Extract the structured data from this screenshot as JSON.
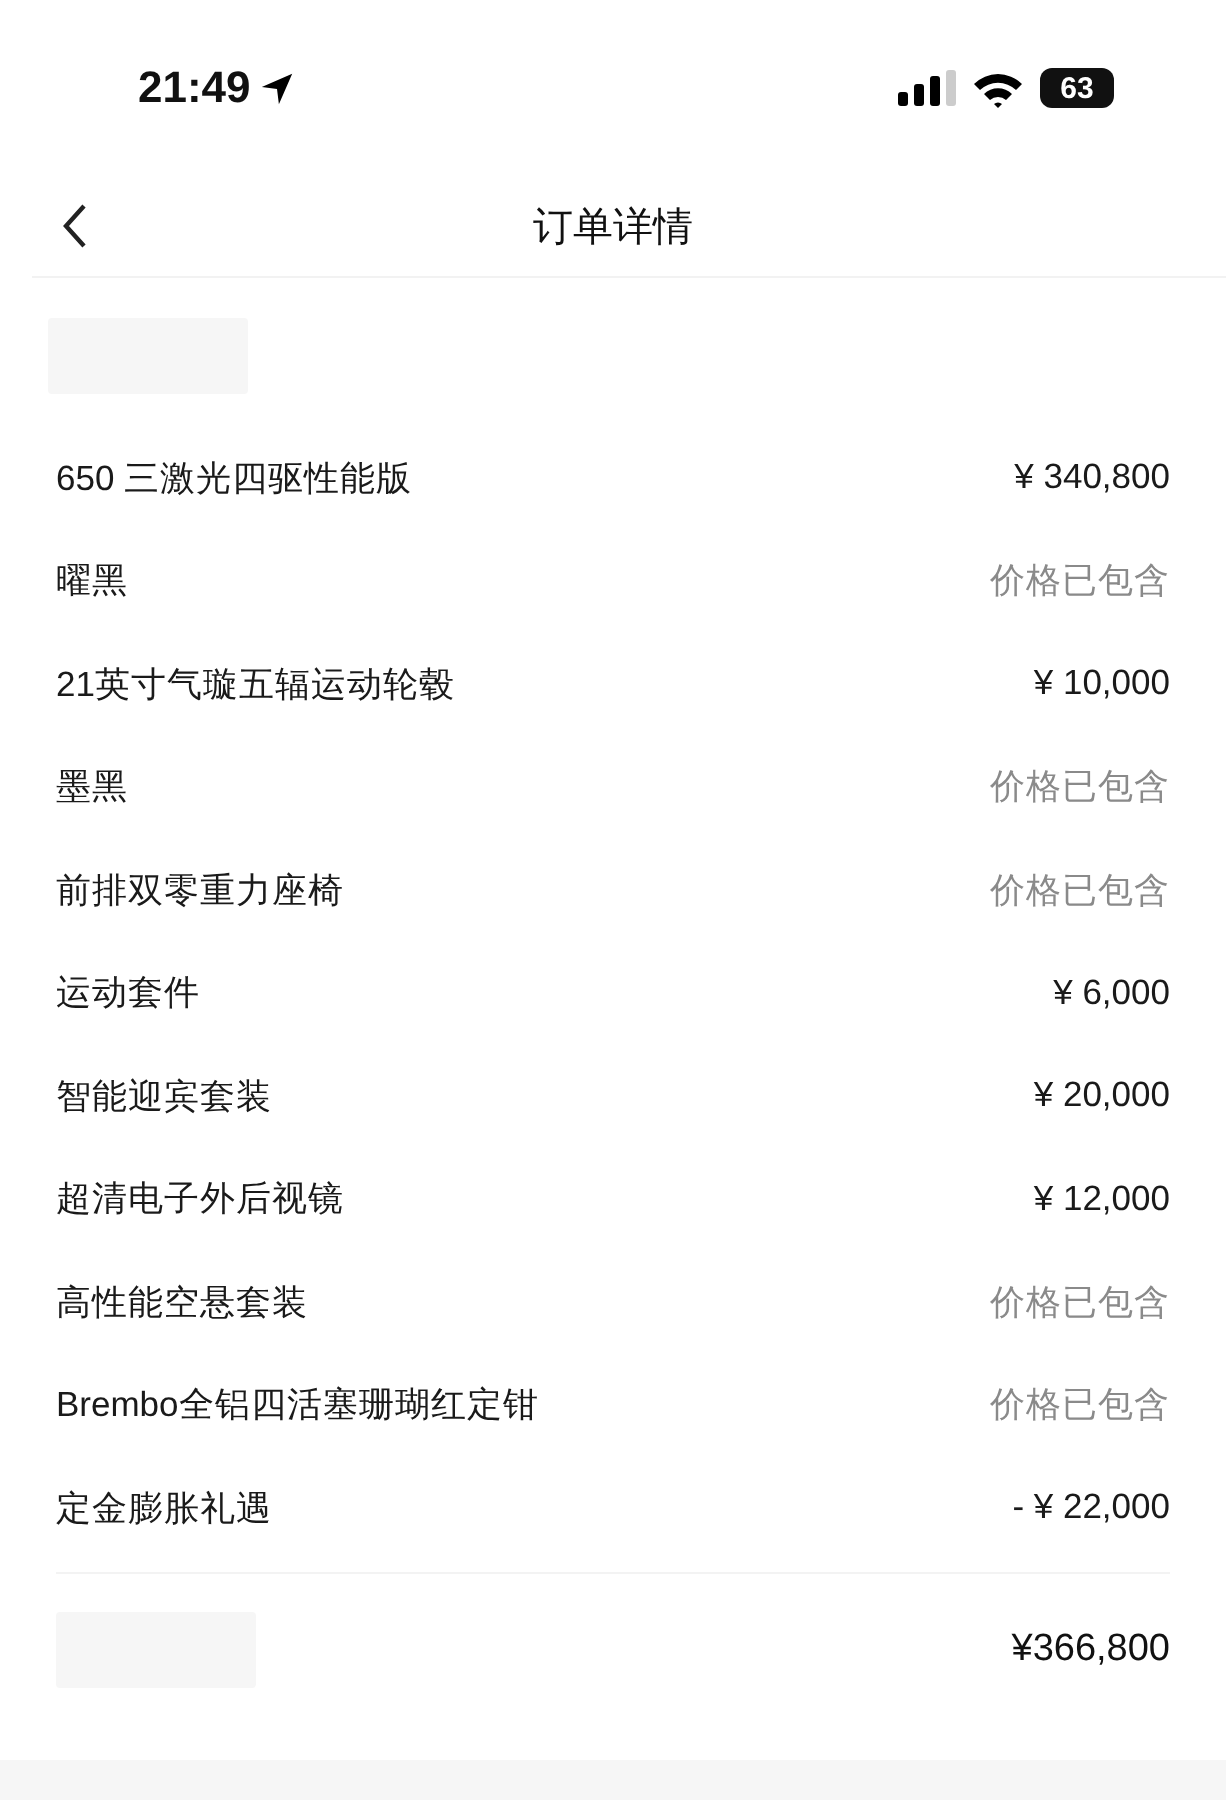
{
  "status_bar": {
    "time": "21:49",
    "battery": "63"
  },
  "nav": {
    "title": "订单详情"
  },
  "items": [
    {
      "name": "650 三激光四驱性能版",
      "price": "¥ 340,800",
      "kind": "price"
    },
    {
      "name": "曜黑",
      "price": "价格已包含",
      "kind": "included"
    },
    {
      "name": "21英寸气璇五辐运动轮毂",
      "price": "¥ 10,000",
      "kind": "price"
    },
    {
      "name": "墨黑",
      "price": "价格已包含",
      "kind": "included"
    },
    {
      "name": "前排双零重力座椅",
      "price": "价格已包含",
      "kind": "included"
    },
    {
      "name": "运动套件",
      "price": "¥ 6,000",
      "kind": "price"
    },
    {
      "name": "智能迎宾套装",
      "price": "¥ 20,000",
      "kind": "price"
    },
    {
      "name": "超清电子外后视镜",
      "price": "¥ 12,000",
      "kind": "price"
    },
    {
      "name": "高性能空悬套装",
      "price": "价格已包含",
      "kind": "included"
    },
    {
      "name": "Brembo全铝四活塞珊瑚红定钳",
      "price": "价格已包含",
      "kind": "included"
    },
    {
      "name": "定金膨胀礼遇",
      "price": "- ¥ 22,000",
      "kind": "price"
    }
  ],
  "total": {
    "amount": "¥366,800"
  }
}
